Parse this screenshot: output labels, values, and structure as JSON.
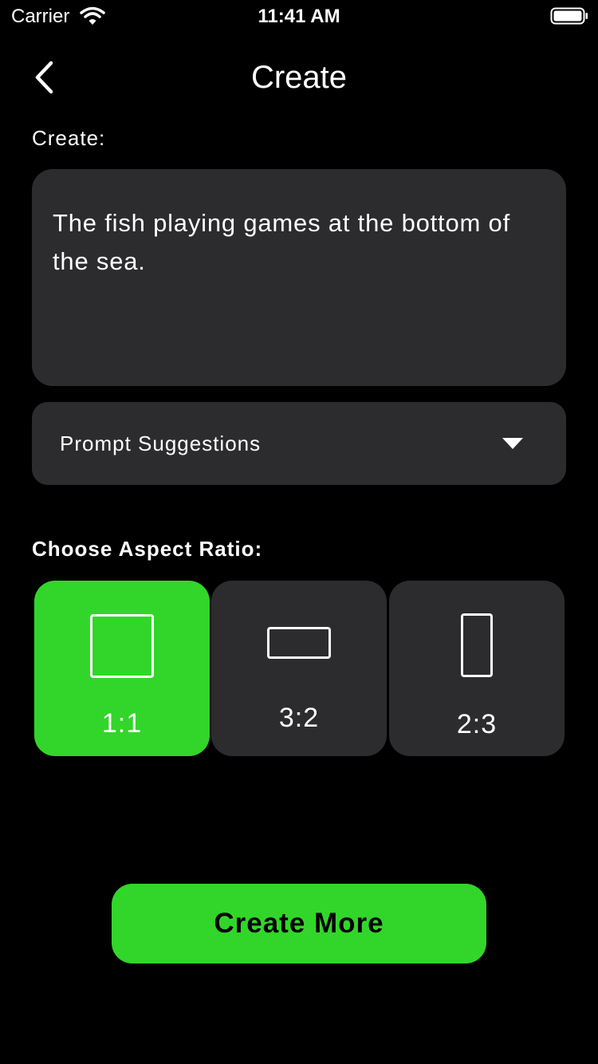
{
  "status_bar": {
    "carrier": "Carrier",
    "time": "11:41 AM",
    "icons": [
      "wifi-icon",
      "battery-icon"
    ]
  },
  "nav": {
    "title": "Create",
    "back_icon": "chevron-left-icon"
  },
  "prompt": {
    "label": "Create:",
    "value": "The fish playing games at the bottom of the sea."
  },
  "suggestions": {
    "label": "Prompt Suggestions",
    "icon": "caret-down-icon"
  },
  "aspect_ratio": {
    "label": "Choose Aspect Ratio:",
    "options": [
      {
        "label": "1:1",
        "icon": "square-icon",
        "selected": true
      },
      {
        "label": "3:2",
        "icon": "landscape-rect-icon",
        "selected": false
      },
      {
        "label": "2:3",
        "icon": "portrait-rect-icon",
        "selected": false
      }
    ]
  },
  "actions": {
    "create_more_label": "Create More"
  },
  "colors": {
    "accent": "#32d62a",
    "background": "#000000",
    "surface": "#2c2c2e",
    "text": "#ffffff"
  }
}
